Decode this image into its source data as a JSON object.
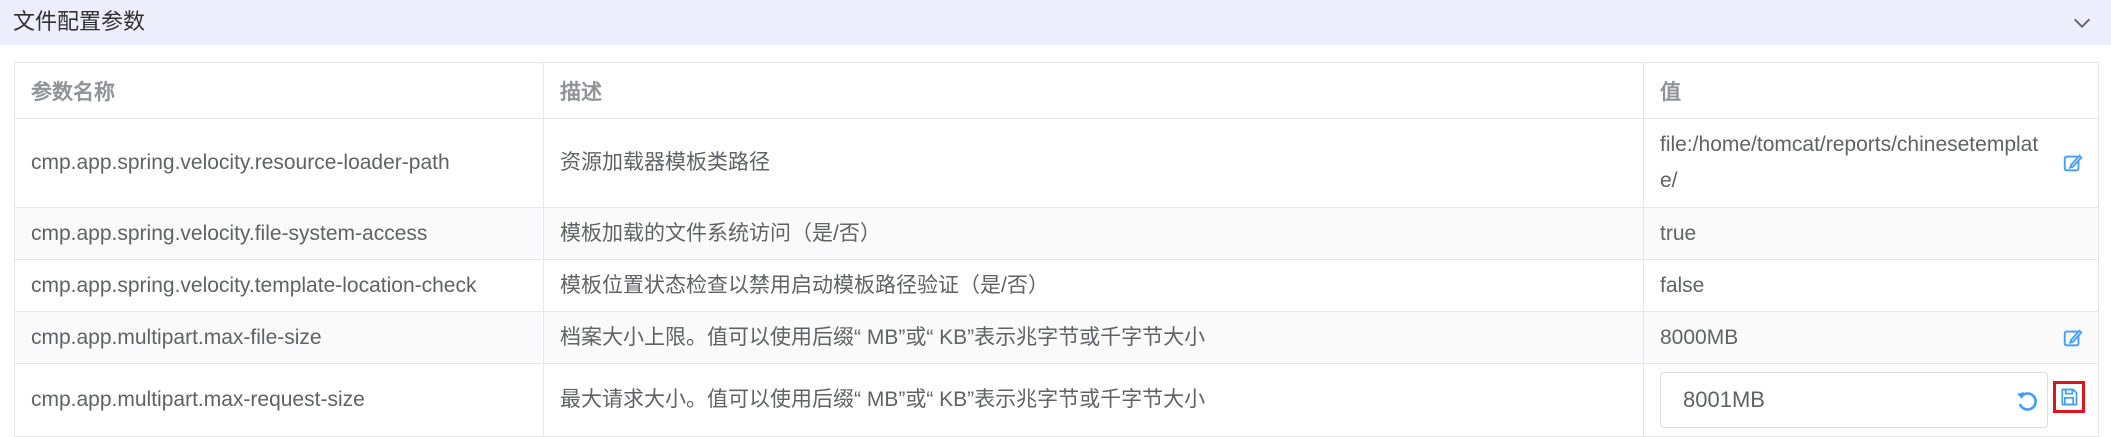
{
  "panel": {
    "title": "文件配置参数",
    "collapse_icon": "chevron-down-icon"
  },
  "table": {
    "columns": [
      "参数名称",
      "描述",
      "值"
    ],
    "rows": [
      {
        "name": "cmp.app.spring.velocity.resource-loader-path",
        "desc": "资源加载器模板类路径",
        "value": "file:/home/tomcat/reports/chinesetemplate/",
        "editable": true
      },
      {
        "name": "cmp.app.spring.velocity.file-system-access",
        "desc": "模板加载的文件系统访问（是/否）",
        "value": "true",
        "editable": false
      },
      {
        "name": "cmp.app.spring.velocity.template-location-check",
        "desc": "模板位置状态检查以禁用启动模板路径验证（是/否）",
        "value": "false",
        "editable": false
      },
      {
        "name": "cmp.app.multipart.max-file-size",
        "desc": "档案大小上限。值可以使用后缀“ MB”或“ KB”表示兆字节或千字节大小",
        "value": "8000MB",
        "editable": true
      },
      {
        "name": "cmp.app.multipart.max-request-size",
        "desc": "最大请求大小。值可以使用后缀“ MB”或“ KB”表示兆字节或千字节大小",
        "value": "8001MB",
        "editing": true
      }
    ]
  },
  "colors": {
    "accent": "#409eff",
    "highlight_border": "#e0141f",
    "header_bg": "#eceefb"
  }
}
